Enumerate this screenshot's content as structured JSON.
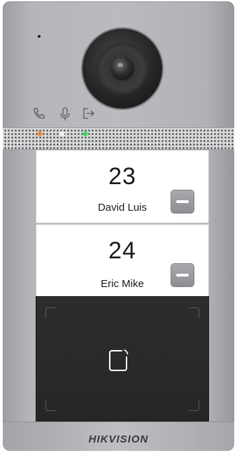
{
  "device": {
    "brand": "HIKVISION",
    "accent_colors": {
      "led_orange": "#f08a2c",
      "led_white": "#f5f5f5",
      "led_green": "#3bd45a",
      "panel": "#b9bbbe",
      "reader": "#262626"
    }
  },
  "status_icons": [
    "phone-icon",
    "microphone-icon",
    "door-exit-icon"
  ],
  "residents": [
    {
      "room": "23",
      "name": "David Luis"
    },
    {
      "room": "24",
      "name": "Eric Mike"
    }
  ],
  "card_reader": {
    "icon": "nfc-card-icon"
  }
}
